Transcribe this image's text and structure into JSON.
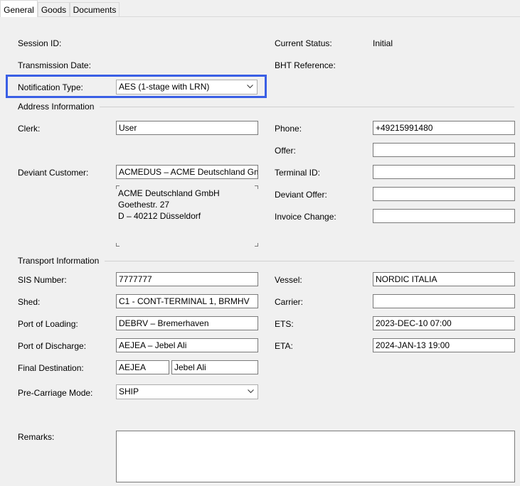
{
  "tabs": [
    {
      "label": "General"
    },
    {
      "label": "Goods"
    },
    {
      "label": "Documents"
    }
  ],
  "header": {
    "session_id_label": "Session ID:",
    "transmission_date_label": "Transmission Date:",
    "notification_type_label": "Notification Type:",
    "notification_type_value": "AES (1-stage with LRN)",
    "current_status_label": "Current Status:",
    "current_status_value": "Initial",
    "bht_reference_label": "BHT Reference:"
  },
  "address": {
    "section_title": "Address Information",
    "clerk_label": "Clerk:",
    "clerk_value": "User",
    "deviant_customer_label": "Deviant Customer:",
    "deviant_customer_value": "ACMEDUS – ACME Deutschland Gml",
    "address_lines": [
      "ACME Deutschland GmbH",
      "Goethestr. 27",
      "D – 40212 Düsseldorf"
    ],
    "phone_label": "Phone:",
    "phone_value": "+49215991480",
    "offer_label": "Offer:",
    "offer_value": "",
    "terminal_id_label": "Terminal ID:",
    "terminal_id_value": "",
    "deviant_offer_label": "Deviant Offer:",
    "deviant_offer_value": "",
    "invoice_change_label": "Invoice Change:",
    "invoice_change_value": ""
  },
  "transport": {
    "section_title": "Transport Information",
    "sis_number_label": "SIS Number:",
    "sis_number_value": "7777777",
    "shed_label": "Shed:",
    "shed_value": "C1 - CONT-TERMINAL 1, BRMHV",
    "port_loading_label": "Port of Loading:",
    "port_loading_value": "DEBRV – Bremerhaven",
    "port_discharge_label": "Port of Discharge:",
    "port_discharge_value": "AEJEA – Jebel Ali",
    "final_destination_label": "Final Destination:",
    "final_destination_code": "AEJEA",
    "final_destination_name": "Jebel Ali",
    "pre_carriage_label": "Pre-Carriage Mode:",
    "pre_carriage_value": "SHIP",
    "vessel_label": "Vessel:",
    "vessel_value": "NORDIC ITALIA",
    "carrier_label": "Carrier:",
    "carrier_value": "",
    "ets_label": "ETS:",
    "ets_value": "2023-DEC-10 07:00",
    "eta_label": "ETA:",
    "eta_value": "2024-JAN-13 19:00"
  },
  "remarks": {
    "label": "Remarks:",
    "value": ""
  },
  "colors": {
    "highlight": "#3a5fe5",
    "panel_bg": "#f0f0f0",
    "field_border": "#7a7a7a"
  }
}
